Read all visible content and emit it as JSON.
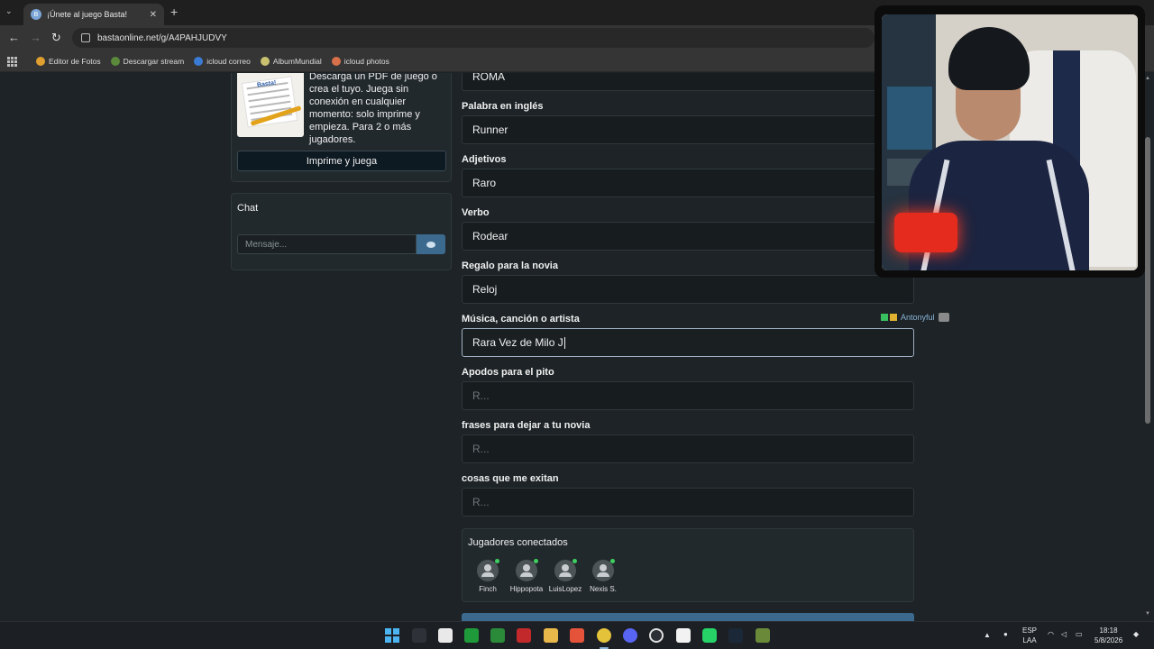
{
  "browser": {
    "tab_title": "¡Únete al juego Basta!",
    "tab_close": "✕",
    "tab_list": "⌄",
    "new_tab": "+",
    "url": "bastaonline.net/g/A4PAHJUDVY",
    "nav": {
      "back": "←",
      "forward": "→",
      "reload": "↻"
    },
    "bookmarks": [
      {
        "label": "Editor de Fotos",
        "color": "#e0a030"
      },
      {
        "label": "Descargar stream",
        "color": "#5a8a3a"
      },
      {
        "label": "icloud correo",
        "color": "#3a7bd5"
      },
      {
        "label": "AlbumMundial",
        "color": "#c9c070"
      },
      {
        "label": "icloud photos",
        "color": "#d8704a"
      }
    ]
  },
  "promo": {
    "image_title": "Basta!",
    "text": "Descarga un PDF de juego o crea el tuyo. Juega sin conexión en cualquier momento: solo imprime y empieza. Para 2 o más jugadores.",
    "button": "Imprime y juega"
  },
  "chat": {
    "title": "Chat",
    "placeholder": "Mensaje..."
  },
  "fields": [
    {
      "label": "",
      "value": "ROMA"
    },
    {
      "label": "Palabra en inglés",
      "value": "Runner"
    },
    {
      "label": "Adjetivos",
      "value": "Raro"
    },
    {
      "label": "Verbo",
      "value": "Rodear"
    },
    {
      "label": "Regalo para la novia",
      "value": "Reloj"
    },
    {
      "label": "Música, canción o artista",
      "value": "Rara Vez de Milo J"
    },
    {
      "label": "Apodos para el pito",
      "value": "R..."
    },
    {
      "label": "frases para dejar a tu novia",
      "value": "R..."
    },
    {
      "label": "cosas que me exitan",
      "value": "R..."
    }
  ],
  "typing_tag": "Antonyful",
  "players": {
    "title": "Jugadores conectados",
    "list": [
      "Finch",
      "Hippopota",
      "LuisLopez",
      "Nexis S."
    ]
  },
  "taskbar": {
    "lang_top": "ESP",
    "lang_bottom": "LAA",
    "time": "18:18",
    "date": "5/8/2026"
  }
}
